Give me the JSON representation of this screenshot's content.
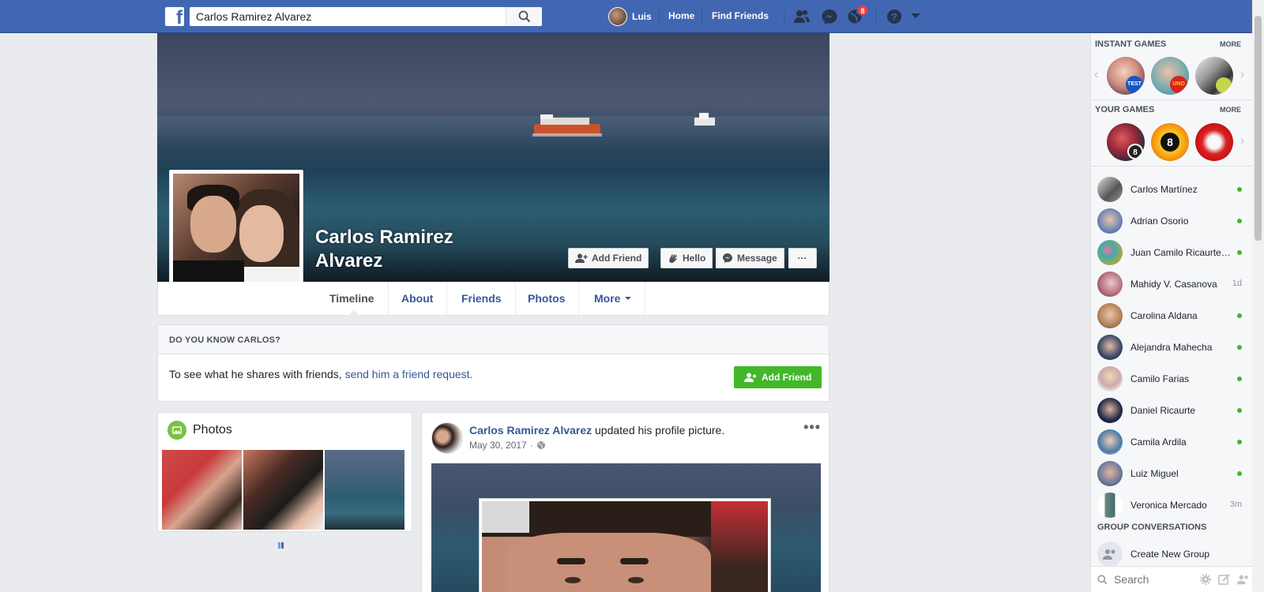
{
  "topbar": {
    "search_value": "Carlos Ramirez Alvarez",
    "user_name": "Luis",
    "home": "Home",
    "find_friends": "Find Friends",
    "notifications_count": "8",
    "brand_color": "#4267b2"
  },
  "profile": {
    "name": "Carlos Ramirez Alvarez",
    "buttons": {
      "add_friend": "Add Friend",
      "hello": "Hello",
      "message": "Message",
      "more": "···"
    },
    "tabs": [
      "Timeline",
      "About",
      "Friends",
      "Photos",
      "More"
    ]
  },
  "know": {
    "title": "DO YOU KNOW CARLOS?",
    "text": "To see what he shares with friends,",
    "link": "send him a friend request.",
    "button": "Add Friend"
  },
  "photos": {
    "title": "Photos"
  },
  "post": {
    "author": "Carlos Ramirez Alvarez",
    "action": " updated his profile picture.",
    "date": "May 30, 2017",
    "more": "•••"
  },
  "sidebar": {
    "instant_games_title": "INSTANT GAMES",
    "your_games_title": "YOUR GAMES",
    "more": "MORE",
    "instant_games": [
      {
        "badge": "TEST"
      },
      {
        "badge": "UNO"
      },
      {
        "badge": ""
      }
    ],
    "your_games": [
      {
        "badge": "8"
      },
      {
        "badge": "8"
      },
      {
        "badge": ""
      }
    ],
    "contacts": [
      {
        "name": "Carlos Martínez",
        "status": "online"
      },
      {
        "name": "Adrian Osorio",
        "status": "online"
      },
      {
        "name": "Juan Camilo Ricaurte…",
        "status": "online"
      },
      {
        "name": "Mahidy V. Casanova",
        "status": "1d"
      },
      {
        "name": "Carolina Aldana",
        "status": "online"
      },
      {
        "name": "Alejandra Mahecha",
        "status": "online"
      },
      {
        "name": "Camilo Farias",
        "status": "online"
      },
      {
        "name": "Daniel Ricaurte",
        "status": "online"
      },
      {
        "name": "Camila Ardila",
        "status": "online"
      },
      {
        "name": "Luiz Miguel",
        "status": "online"
      },
      {
        "name": "Veronica Mercado",
        "status": "3m"
      }
    ],
    "group_title": "GROUP CONVERSATIONS",
    "create_group": "Create New Group",
    "search_placeholder": "Search",
    "online_color": "#42b72a"
  }
}
